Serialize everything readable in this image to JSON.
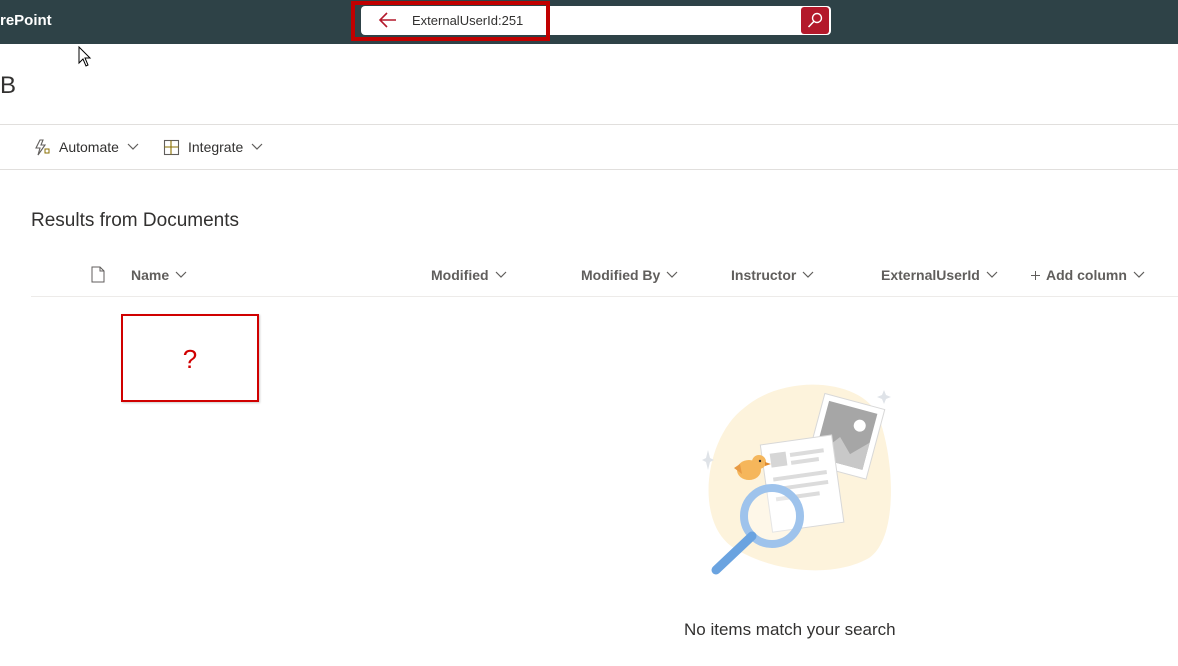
{
  "app": {
    "brand": "rePoint"
  },
  "search": {
    "query": "ExternalUserId:251"
  },
  "site": {
    "title": "B"
  },
  "commands": [
    {
      "label": "Automate"
    },
    {
      "label": "Integrate"
    }
  ],
  "results": {
    "title": "Results from Documents",
    "columns": [
      {
        "label": "Name"
      },
      {
        "label": "Modified"
      },
      {
        "label": "Modified By"
      },
      {
        "label": "Instructor"
      },
      {
        "label": "ExternalUserId"
      },
      {
        "label": "Add column"
      }
    ],
    "empty_message": "No items match your search"
  },
  "annotation": {
    "mark": "?"
  },
  "colors": {
    "topbar": "#2e4247",
    "accent": "#b3192b",
    "highlight": "#c00000"
  },
  "icons": [
    "back-arrow-icon",
    "search-icon",
    "automate-icon",
    "integrate-icon",
    "file-icon",
    "chevron-down-icon",
    "plus-icon",
    "mouse-cursor-icon"
  ]
}
